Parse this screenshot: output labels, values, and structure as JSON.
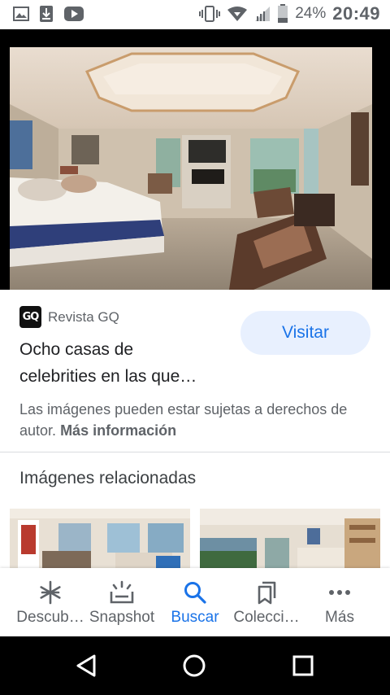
{
  "status_bar": {
    "battery": "24%",
    "time": "20:49"
  },
  "result": {
    "source": "Revista GQ",
    "source_logo_text": "GQ",
    "title_line1": "Ocho casas de",
    "title_line2": "celebrities en las que…",
    "visit_label": "Visitar",
    "copyright_text": "Las imágenes pueden estar sujetas a derechos de autor.",
    "copyright_link": "Más información"
  },
  "related": {
    "title": "Imágenes relacionadas"
  },
  "bottom_nav": {
    "items": [
      {
        "label": "Descub…",
        "icon": "asterisk-icon"
      },
      {
        "label": "Snapshot",
        "icon": "snapshot-icon"
      },
      {
        "label": "Buscar",
        "icon": "search-icon",
        "active": true
      },
      {
        "label": "Colecci…",
        "icon": "bookmarks-icon"
      },
      {
        "label": "Más",
        "icon": "more-horizontal-icon"
      }
    ]
  },
  "colors": {
    "accent": "#1a73e8",
    "visit_bg": "#e8f0fe",
    "text_secondary": "#5f6368"
  }
}
